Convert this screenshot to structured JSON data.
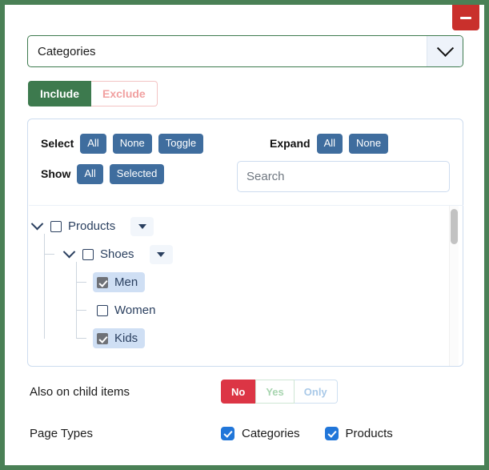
{
  "window": {
    "collapse_button_icon": "minus-icon",
    "collapse_button_label": "",
    "border_color": "#4a8056"
  },
  "field_select": {
    "value": "Categories",
    "caret_icon": "chevron-down-icon"
  },
  "include_exclude": {
    "include_label": "Include",
    "exclude_label": "Exclude",
    "active": "Include",
    "include_color": "#3d7a4e",
    "exclude_color": "#f1a0a0"
  },
  "tree_toolbar": {
    "select_label": "Select",
    "select_buttons": [
      "All",
      "None",
      "Toggle"
    ],
    "expand_label": "Expand",
    "expand_buttons": [
      "All",
      "None"
    ],
    "show_label": "Show",
    "show_buttons": [
      "All",
      "Selected"
    ],
    "button_color": "#3f6d9e",
    "search": {
      "value": "",
      "placeholder": "Search"
    }
  },
  "tree": {
    "scrollbar": {
      "visible": true,
      "thumb_position": "top"
    },
    "nodes": [
      {
        "label": "Products",
        "checked": false,
        "selected": false,
        "expanded": true,
        "has_menu": true,
        "chevron_icon": "chevron-down-icon",
        "menu_icon": "caret-down-icon",
        "children": [
          {
            "label": "Shoes",
            "checked": false,
            "selected": false,
            "expanded": true,
            "has_menu": true,
            "chevron_icon": "chevron-down-icon",
            "menu_icon": "caret-down-icon",
            "children": [
              {
                "label": "Men",
                "checked": true,
                "selected": true,
                "expanded": false,
                "has_menu": false,
                "children": []
              },
              {
                "label": "Women",
                "checked": false,
                "selected": false,
                "expanded": false,
                "has_menu": false,
                "children": []
              },
              {
                "label": "Kids",
                "checked": true,
                "selected": true,
                "expanded": false,
                "has_menu": false,
                "children": []
              }
            ]
          }
        ]
      }
    ]
  },
  "child_items": {
    "label": "Also on child items",
    "options": [
      "No",
      "Yes",
      "Only"
    ],
    "active": "No",
    "active_color": "#dc3545"
  },
  "page_types": {
    "label": "Page Types",
    "items": [
      {
        "label": "Categories",
        "checked": true
      },
      {
        "label": "Products",
        "checked": true
      }
    ],
    "checkbox_color": "#2176d9"
  }
}
